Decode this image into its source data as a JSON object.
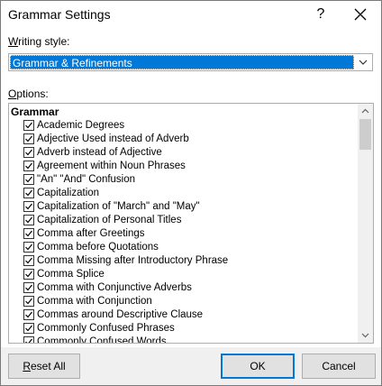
{
  "dialog": {
    "title": "Grammar Settings",
    "help_label": "?",
    "close_icon": "close-icon"
  },
  "writing_style": {
    "label_underlined": "W",
    "label_rest": "riting style:",
    "selected_value": "Grammar & Refinements",
    "dropdown_icon": "chevron-down-icon"
  },
  "options": {
    "label_underlined": "O",
    "label_rest": "ptions:",
    "group_header": "Grammar",
    "items": [
      {
        "label": "Academic Degrees",
        "checked": true
      },
      {
        "label": "Adjective Used instead of Adverb",
        "checked": true
      },
      {
        "label": "Adverb instead of Adjective",
        "checked": true
      },
      {
        "label": "Agreement within Noun Phrases",
        "checked": true
      },
      {
        "label": "\"An\" \"And\" Confusion",
        "checked": true
      },
      {
        "label": "Capitalization",
        "checked": true
      },
      {
        "label": "Capitalization of \"March\" and \"May\"",
        "checked": true
      },
      {
        "label": "Capitalization of Personal Titles",
        "checked": true
      },
      {
        "label": "Comma after Greetings",
        "checked": true
      },
      {
        "label": "Comma before Quotations",
        "checked": true
      },
      {
        "label": "Comma Missing after Introductory Phrase",
        "checked": true
      },
      {
        "label": "Comma Splice",
        "checked": true
      },
      {
        "label": "Comma with Conjunctive Adverbs",
        "checked": true
      },
      {
        "label": "Comma with Conjunction",
        "checked": true
      },
      {
        "label": "Commas around Descriptive Clause",
        "checked": true
      },
      {
        "label": "Commonly Confused Phrases",
        "checked": true
      },
      {
        "label": "Commonly Confused Words",
        "checked": true
      }
    ]
  },
  "buttons": {
    "reset_underlined": "R",
    "reset_rest": "eset All",
    "ok": "OK",
    "cancel": "Cancel"
  }
}
